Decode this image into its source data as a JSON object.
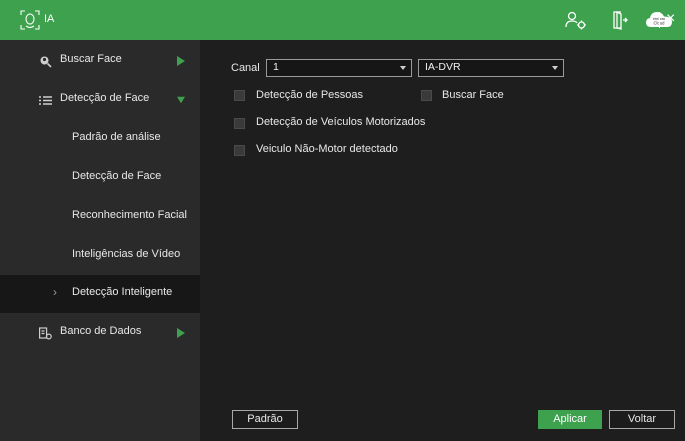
{
  "header": {
    "title": "IA",
    "icons": [
      "face-scan-icon",
      "user-settings-icon",
      "logout-icon",
      "intelbras-cloud-icon",
      "close-icon"
    ],
    "cloud_label": "Cloud",
    "cloud_brand": "intelbras",
    "close_label": "×"
  },
  "sidebar": {
    "items": [
      {
        "label": "Buscar Face",
        "icon": "face-search-icon",
        "arrow": "right"
      },
      {
        "label": "Detecção de Face",
        "icon": "list-icon",
        "arrow": "down"
      },
      {
        "label": "Padrão de análise"
      },
      {
        "label": "Detecção de Face"
      },
      {
        "label": "Reconhecimento Facial"
      },
      {
        "label": "Inteligências de Vídeo"
      },
      {
        "label": "Detecção Inteligente",
        "active": true,
        "marker": "›"
      },
      {
        "label": "Banco de Dados",
        "icon": "database-icon",
        "arrow": "right"
      }
    ]
  },
  "main": {
    "canal_label": "Canal",
    "channel_value": "1",
    "type_value": "IA-DVR",
    "options": [
      {
        "label": "Detecção de Pessoas",
        "checked": false
      },
      {
        "label": "Buscar Face",
        "checked": false
      },
      {
        "label": "Detecção de Veículos Motorizados",
        "checked": false
      },
      {
        "label": "Veiculo Não-Motor detectado",
        "checked": false
      }
    ]
  },
  "footer": {
    "default_label": "Padrão",
    "apply_label": "Aplicar",
    "back_label": "Voltar"
  },
  "colors": {
    "accent": "#3ea14e",
    "background": "#1e1e1e",
    "sidebar": "#2a2a2a",
    "sidebar_active": "#171717"
  }
}
